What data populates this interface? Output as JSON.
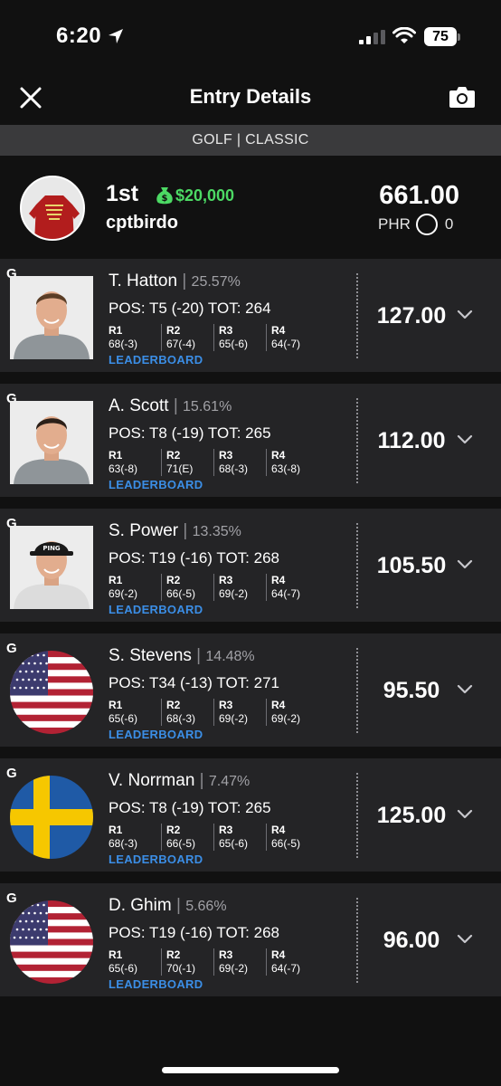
{
  "status_bar": {
    "time": "6:20",
    "battery": "75"
  },
  "nav": {
    "title": "Entry Details"
  },
  "contest": {
    "label": "GOLF | CLASSIC"
  },
  "entry": {
    "place": "1st",
    "prize": "$20,000",
    "username": "cptbirdo",
    "total_points": "661.00",
    "phr_label": "PHR",
    "phr_value": "0"
  },
  "round_labels": [
    "R1",
    "R2",
    "R3",
    "R4"
  ],
  "leaderboard_label": "LEADERBOARD",
  "players": [
    {
      "pos_tag": "G",
      "name": "T. Hatton",
      "ownership": "25.57%",
      "pos_tot": "POS: T5 (-20) TOT: 264",
      "rounds": [
        "68(-3)",
        "67(-4)",
        "65(-6)",
        "64(-7)"
      ],
      "points": "127.00",
      "image": "headshot"
    },
    {
      "pos_tag": "G",
      "name": "A. Scott",
      "ownership": "15.61%",
      "pos_tot": "POS: T8 (-19) TOT: 265",
      "rounds": [
        "63(-8)",
        "71(E)",
        "68(-3)",
        "63(-8)"
      ],
      "points": "112.00",
      "image": "headshot"
    },
    {
      "pos_tag": "G",
      "name": "S. Power",
      "ownership": "13.35%",
      "pos_tot": "POS: T19 (-16) TOT: 268",
      "rounds": [
        "69(-2)",
        "66(-5)",
        "69(-2)",
        "64(-7)"
      ],
      "points": "105.50",
      "image": "headshot"
    },
    {
      "pos_tag": "G",
      "name": "S. Stevens",
      "ownership": "14.48%",
      "pos_tot": "POS: T34 (-13) TOT: 271",
      "rounds": [
        "65(-6)",
        "68(-3)",
        "69(-2)",
        "69(-2)"
      ],
      "points": "95.50",
      "image": "usa-flag"
    },
    {
      "pos_tag": "G",
      "name": "V. Norrman",
      "ownership": "7.47%",
      "pos_tot": "POS: T8 (-19) TOT: 265",
      "rounds": [
        "68(-3)",
        "66(-5)",
        "65(-6)",
        "66(-5)"
      ],
      "points": "125.00",
      "image": "sweden-flag"
    },
    {
      "pos_tag": "G",
      "name": "D. Ghim",
      "ownership": "5.66%",
      "pos_tot": "POS: T19 (-16) TOT: 268",
      "rounds": [
        "65(-6)",
        "70(-1)",
        "69(-2)",
        "64(-7)"
      ],
      "points": "96.00",
      "image": "usa-flag"
    }
  ],
  "colors": {
    "prize_green": "#4cd964",
    "link_blue": "#3b8ee6",
    "card_bg": "#242426",
    "bar_bg": "#3a3a3c"
  },
  "icons": [
    "location-arrow-icon",
    "signal-icon",
    "wifi-icon",
    "close-icon",
    "camera-icon",
    "money-bag-icon",
    "chevron-down-icon"
  ]
}
